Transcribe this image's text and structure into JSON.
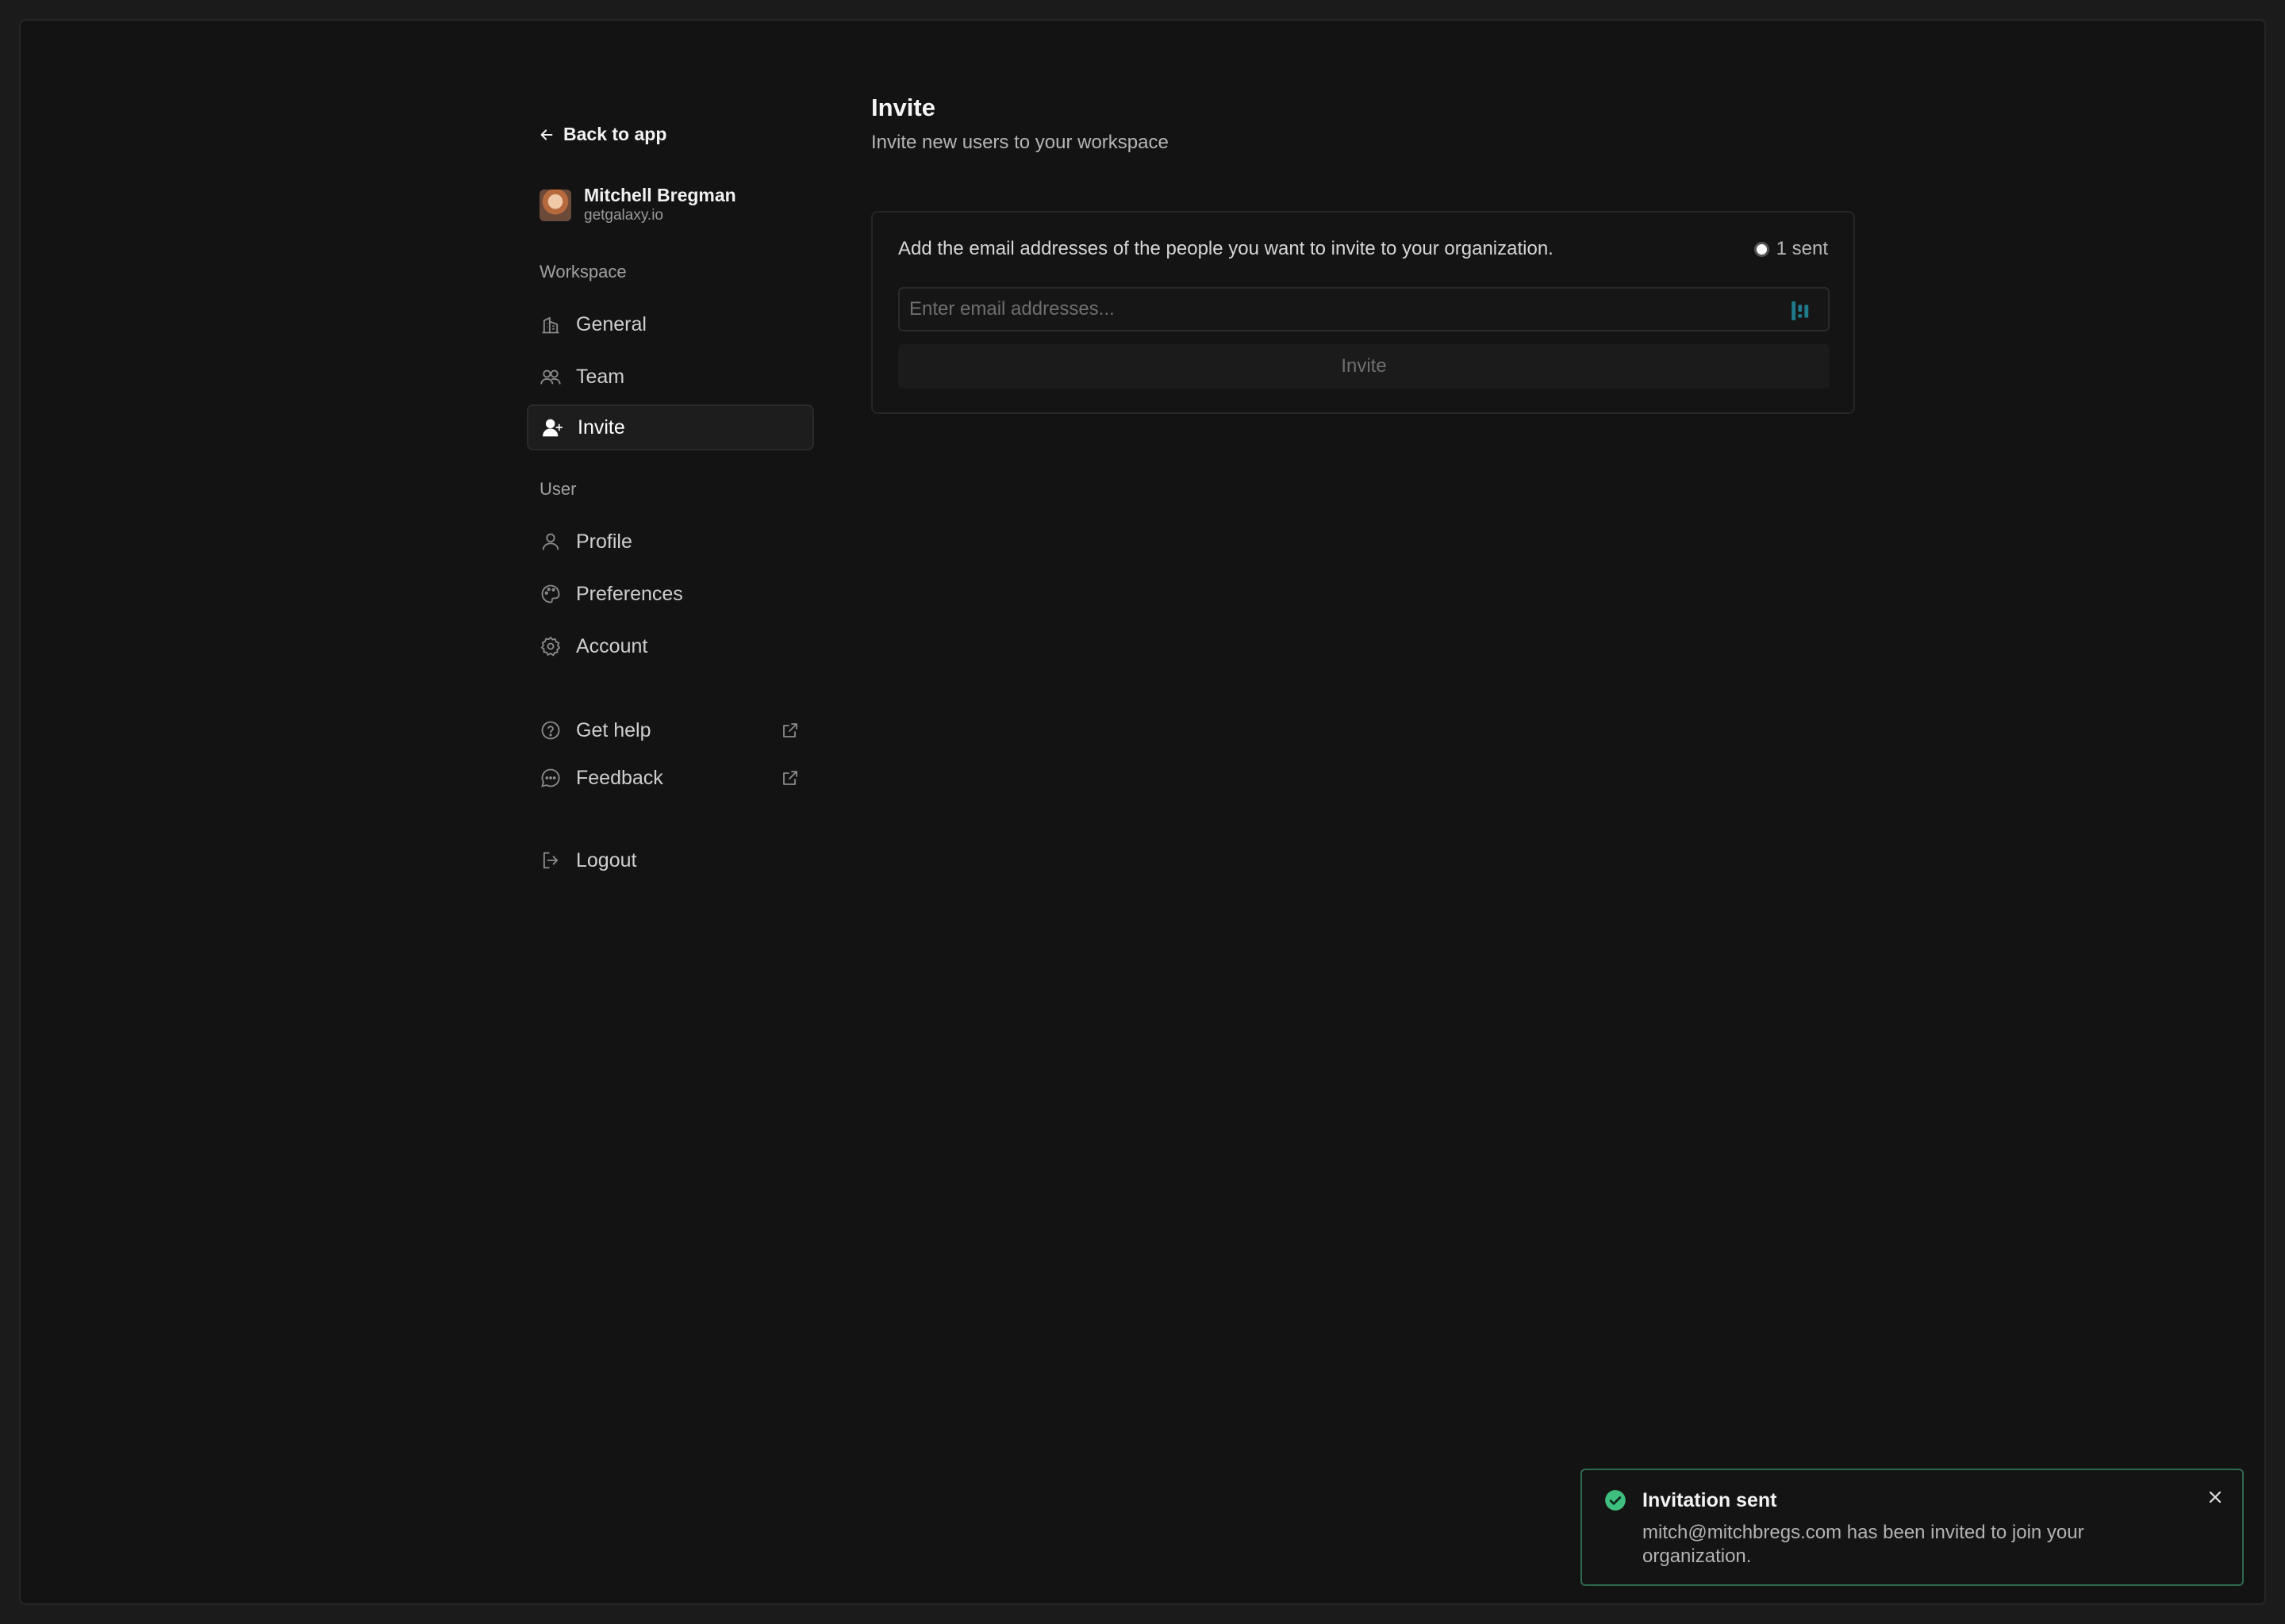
{
  "sidebar": {
    "back_label": "Back to app",
    "user": {
      "name": "Mitchell Bregman",
      "domain": "getgalaxy.io"
    },
    "workspace_label": "Workspace",
    "workspace_items": [
      {
        "label": "General",
        "icon": "building-icon"
      },
      {
        "label": "Team",
        "icon": "users-icon"
      },
      {
        "label": "Invite",
        "icon": "user-plus-icon",
        "active": true
      }
    ],
    "user_label": "User",
    "user_items": [
      {
        "label": "Profile",
        "icon": "user-icon"
      },
      {
        "label": "Preferences",
        "icon": "palette-icon"
      },
      {
        "label": "Account",
        "icon": "gear-icon"
      }
    ],
    "help_label": "Get help",
    "feedback_label": "Feedback",
    "logout_label": "Logout"
  },
  "main": {
    "title": "Invite",
    "subtitle": "Invite new users to your workspace",
    "card": {
      "description": "Add the email addresses of the people you want to invite to your organization.",
      "sent_count": "1 sent",
      "email_placeholder": "Enter email addresses...",
      "invite_button": "Invite"
    }
  },
  "toast": {
    "title": "Invitation sent",
    "message": "mitch@mitchbregs.com has been invited to join your organization."
  },
  "colors": {
    "background": "#131313",
    "success": "#3fbf7f",
    "input_icon": "#1f7a8c"
  }
}
